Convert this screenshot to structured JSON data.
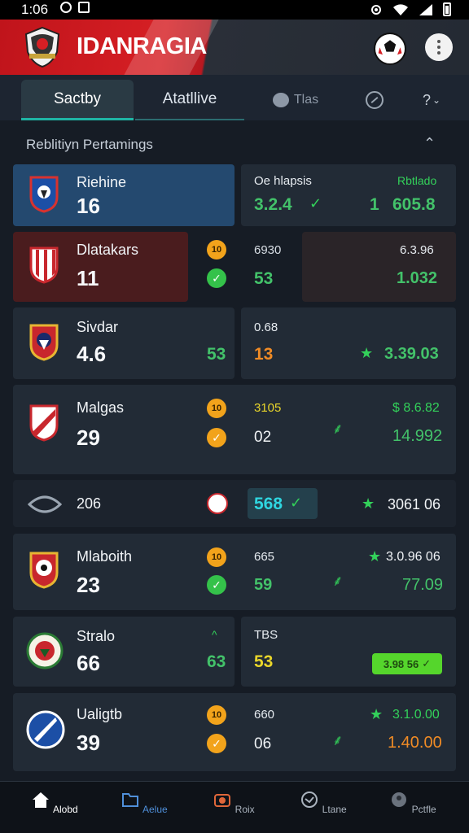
{
  "status_bar": {
    "time": "1:06"
  },
  "header": {
    "title": "IDANRAGIA"
  },
  "tabs": [
    {
      "label": "Sactby"
    },
    {
      "label": "Atatllive"
    },
    {
      "label": "Tlas"
    },
    {
      "label": ""
    },
    {
      "label": "?"
    }
  ],
  "section": {
    "title": "Reblitiyn Pertamings"
  },
  "rows": [
    {
      "team": "Riehine",
      "score": "16",
      "right_label": "Oe hlapsis",
      "right_tag": "Rbtlado",
      "right_value1": "3.2.4",
      "right_mid": "1",
      "right_value2": "605.8"
    },
    {
      "team": "Dlatakars",
      "score": "11",
      "coin": "10",
      "mid_top": "6930",
      "mid_bottom": "53",
      "right_top": "6.3.96",
      "right_bottom": "1.032"
    },
    {
      "team": "Sivdar",
      "score": "4.6",
      "mid_score": "53",
      "right_label": "0.68",
      "right_value1": "13",
      "right_value2": "3.39.03"
    },
    {
      "team": "Malgas",
      "score": "29",
      "coin": "10",
      "mid_top": "3105",
      "mid_bottom": "02",
      "right_top": "$ 8.6.82",
      "right_bottom": "14.992"
    },
    {
      "team": "206",
      "mid_value": "568",
      "right_value": "3061 06"
    },
    {
      "team": "Mlaboith",
      "score": "23",
      "coin": "10",
      "mid_top": "665",
      "mid_bottom": "59",
      "right_top": "3.0.96 06",
      "right_bottom": "77.09"
    },
    {
      "team": "Stralo",
      "score": "66",
      "mid_top": "^",
      "mid_score": "63",
      "right_label": "TBS",
      "right_value1": "53",
      "right_pill": "3.98 56"
    },
    {
      "team": "Ualigtb",
      "score": "39",
      "coin": "10",
      "mid_top": "660",
      "mid_bottom": "06",
      "right_top": "3.1.0.00",
      "right_bottom": "1.40.00"
    }
  ],
  "bottom_nav": [
    {
      "label": "Alobd",
      "icon": "home-icon"
    },
    {
      "label": "Aelue",
      "icon": "folder-icon"
    },
    {
      "label": "Roix",
      "icon": "camera-icon"
    },
    {
      "label": "Ltane",
      "icon": "clock-icon"
    },
    {
      "label": "Pctfle",
      "icon": "profile-icon"
    }
  ],
  "colors": {
    "brand_red": "#d61f24",
    "accent_teal": "#1fb5a4",
    "positive_green": "#33d15a",
    "warning_orange": "#f08b25"
  }
}
